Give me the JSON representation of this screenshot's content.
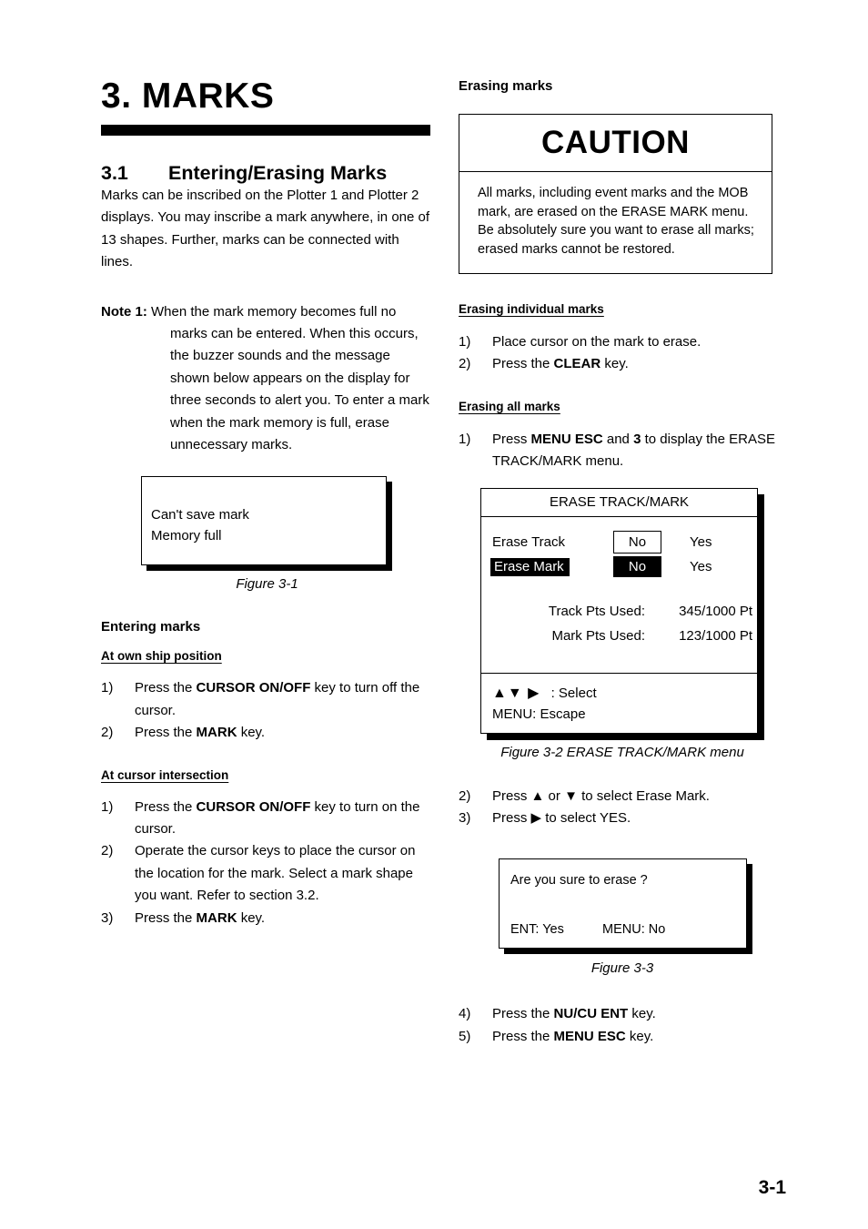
{
  "chapter": {
    "title": "3. MARKS"
  },
  "section": {
    "number": "3.1",
    "title": "Entering/Erasing Marks",
    "intro": "Marks can be inscribed on the Plotter 1 and Plotter 2 displays. You may inscribe a mark anywhere, in one of 13 shapes. Further, marks can be connected with lines."
  },
  "note1": {
    "label": "Note 1:",
    "text": "When the mark memory becomes full no marks can be entered. When this occurs, the buzzer sounds and the message shown below appears on the display for three seconds to alert you. To enter a mark when the mark memory is full, erase unnecessary marks."
  },
  "figure_3_1": {
    "line1": "Can't save mark",
    "line2": "Memory full",
    "caption": "Figure 3-1"
  },
  "entering_marks": {
    "heading": "Entering marks",
    "own_ship": {
      "heading": "At own ship position",
      "steps": [
        {
          "marker": "1)",
          "pre": "Press the ",
          "key": "CURSOR ON/OFF",
          "post": " key to turn off the cursor."
        },
        {
          "marker": "2)",
          "pre": "Press the ",
          "key": "MARK",
          "post": " key."
        }
      ]
    },
    "cursor_intersection": {
      "heading": "At cursor intersection",
      "steps": [
        {
          "marker": "1)",
          "pre": "Press the ",
          "key": "CURSOR ON/OFF",
          "post": " key to turn on the cursor."
        },
        {
          "marker": "2)",
          "pre": "Operate the cursor keys to place the cursor on the location for the mark. Select a mark shape you want. Refer to section 3.2.",
          "key": "",
          "post": ""
        },
        {
          "marker": "3)",
          "pre": "Press the ",
          "key": "MARK",
          "post": " key."
        }
      ]
    }
  },
  "erasing_marks": {
    "heading": "Erasing marks",
    "caution": {
      "title": "CAUTION",
      "body": "All marks, including event marks and the MOB mark, are erased on the ERASE MARK menu. Be absolutely sure you want to erase all marks; erased marks cannot be restored."
    },
    "individual": {
      "heading": "Erasing individual marks",
      "steps": [
        {
          "marker": "1)",
          "pre": "Place cursor on the mark to erase.",
          "key": "",
          "post": ""
        },
        {
          "marker": "2)",
          "pre": "Press the ",
          "key": "CLEAR",
          "post": " key."
        }
      ]
    },
    "all": {
      "heading": "Erasing all marks",
      "step1": {
        "marker": "1)",
        "pre": "Press ",
        "key1": "MENU ESC",
        "mid": " and ",
        "key2": "3",
        "post": " to display the ERASE TRACK/MARK menu."
      },
      "step2": {
        "marker": "2)",
        "pre": "Press ",
        "arrow_up": "▲",
        "mid": " or ",
        "arrow_down": "▼",
        "post": " to select Erase Mark."
      },
      "step3": {
        "marker": "3)",
        "pre": "Press ",
        "arrow_right": "▶",
        "post": " to select YES."
      },
      "step4": {
        "marker": "4)",
        "pre": "Press the ",
        "key": "NU/CU ENT",
        "post": " key."
      },
      "step5": {
        "marker": "5)",
        "pre": "Press the ",
        "key": "MENU ESC",
        "post": " key."
      }
    }
  },
  "figure_3_2": {
    "menu_title": "ERASE TRACK/MARK",
    "rows": [
      {
        "label": "Erase Track",
        "no": "No",
        "yes": "Yes",
        "selected_label": false,
        "no_state": "boxed"
      },
      {
        "label": "Erase Mark",
        "no": "No",
        "yes": "Yes",
        "selected_label": true,
        "no_state": "inverted"
      }
    ],
    "stats": [
      {
        "label": "Track Pts Used:",
        "value": "345/1000 Pt"
      },
      {
        "label": "Mark Pts Used:",
        "value": "123/1000 Pt"
      }
    ],
    "footer": {
      "arrows": "▲▼ ▶",
      "select_text": ": Select",
      "escape_text": "MENU: Escape"
    },
    "caption": "Figure 3-2 ERASE TRACK/MARK menu"
  },
  "figure_3_3": {
    "question": "Are you sure to erase ?",
    "key_ent": "ENT: Yes",
    "key_menu": "MENU: No",
    "caption": "Figure 3-3"
  },
  "page_number": "3-1"
}
